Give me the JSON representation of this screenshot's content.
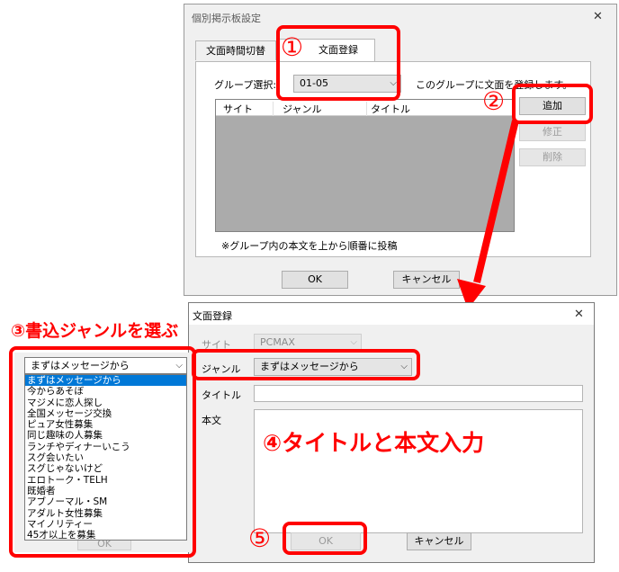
{
  "dialog1": {
    "title": "個別掲示板設定",
    "close": "✕",
    "tabs": [
      "文面時間切替",
      "文面登録"
    ],
    "group_label": "グループ選択:",
    "group_value": "01-05",
    "group_hint": "このグループに文面を登録します。",
    "columns": [
      "サイト",
      "ジャンル",
      "タイトル"
    ],
    "buttons": {
      "add": "追加",
      "edit": "修正",
      "delete": "削除"
    },
    "note": "※グループ内の本文を上から順番に投稿",
    "ok": "OK",
    "cancel": "キャンセル"
  },
  "dialog2": {
    "title": "文面登録",
    "close": "✕",
    "site_label": "サイト",
    "site_value": "PCMAX",
    "genre_label": "ジャンル",
    "genre_value": "まずはメッセージから",
    "title_label": "タイトル",
    "body_label": "本文",
    "ok": "OK",
    "cancel": "キャンセル"
  },
  "dropdown": {
    "selected": "まずはメッセージから",
    "options": [
      "まずはメッセージから",
      "今からあそぼ",
      "マジメに恋人探し",
      "全国メッセージ交換",
      "ピュア女性募集",
      "同じ趣味の人募集",
      "ランチやディナーいこう",
      "スグ会いたい",
      "スグじゃないけど",
      "エロトーク・TELH",
      "既婚者",
      "アブノーマル・SM",
      "アダルト女性募集",
      "マイノリティー",
      "45才以上を募集"
    ],
    "behind_ok": "OK"
  },
  "annotations": {
    "n1": "①",
    "n2": "②",
    "n3": "③書込ジャンルを選ぶ",
    "n4": "④タイトルと本文入力",
    "n5": "⑤"
  },
  "colors": {
    "annotation_red": "#ff0000",
    "selection_blue": "#0078d7",
    "list_gray": "#ababab"
  }
}
